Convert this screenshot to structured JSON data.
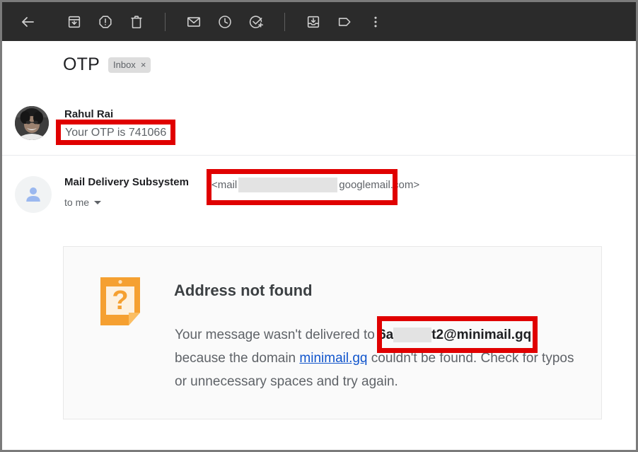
{
  "toolbar": {
    "items": [
      {
        "name": "back-arrow-icon",
        "label": "Back to Inbox"
      },
      {
        "name": "archive-icon",
        "label": "Archive"
      },
      {
        "name": "report-spam-icon",
        "label": "Report spam"
      },
      {
        "name": "delete-icon",
        "label": "Delete"
      },
      {
        "name": "mark-unread-icon",
        "label": "Mark as unread"
      },
      {
        "name": "snooze-clock-icon",
        "label": "Snooze"
      },
      {
        "name": "add-to-tasks-icon",
        "label": "Add to Tasks"
      },
      {
        "name": "move-to-inbox-icon",
        "label": "Move to Inbox"
      },
      {
        "name": "labels-tag-icon",
        "label": "Labels"
      },
      {
        "name": "more-options-icon",
        "label": "More"
      }
    ],
    "background_color": "#2b2b2b"
  },
  "subject": {
    "title": "OTP",
    "label_chip": "Inbox",
    "label_chip_remove": "×"
  },
  "messages": [
    {
      "sender": "Rahul Rai",
      "snippet": "Your OTP is 741066",
      "avatar": "photo-avatar"
    },
    {
      "sender": "Mail Delivery Subsystem",
      "email_prefix": "<mail",
      "email_suffix": "googlemail.com>",
      "recipient": "to me",
      "avatar": "default-person-avatar"
    }
  ],
  "bounce_card": {
    "icon": "orange-question-document-icon",
    "title": "Address not found",
    "body_lead": "Your message wasn't delivered to",
    "address_prefix": "6a",
    "address_suffix": "t2@minimail.gq",
    "body_mid": "because the domain",
    "domain_link": "minimail.gq",
    "body_tail": "couldn't be found. Check for typos or unnecessary spaces and try again."
  },
  "annotations": {
    "color": "#e00000",
    "boxes": [
      {
        "name": "redbox-otp-snippet"
      },
      {
        "name": "redbox-sender-email"
      },
      {
        "name": "redbox-recipient-address"
      }
    ]
  }
}
